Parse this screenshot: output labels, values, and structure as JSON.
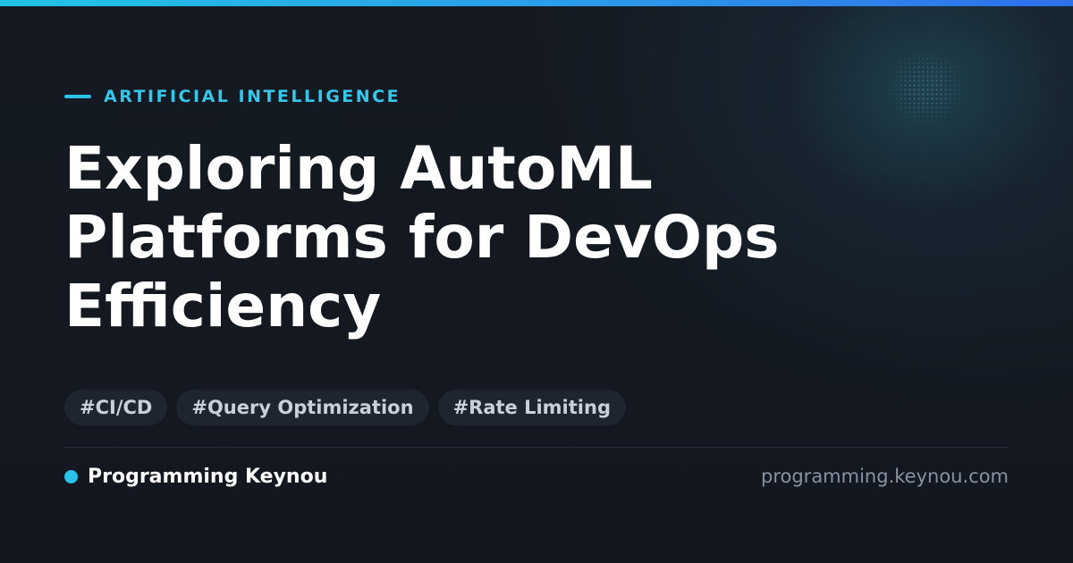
{
  "category": {
    "label": "ARTIFICIAL INTELLIGENCE"
  },
  "title": {
    "lines": [
      "Exploring AutoML",
      "Platforms for DevOps",
      "Efficiency"
    ]
  },
  "tags": [
    "#CI/CD",
    "#Query Optimization",
    "#Rate Limiting"
  ],
  "footer": {
    "brand_name": "Programming Keynou",
    "url": "programming.keynou.com"
  },
  "colors": {
    "accent": "#29c2e8",
    "background": "#141821",
    "tag_background": "#1d2531",
    "title_text": "#ffffff",
    "url_text": "#8792a2"
  },
  "icons": {
    "category_marker": "accent-dash",
    "brand_marker": "accent-dot"
  }
}
